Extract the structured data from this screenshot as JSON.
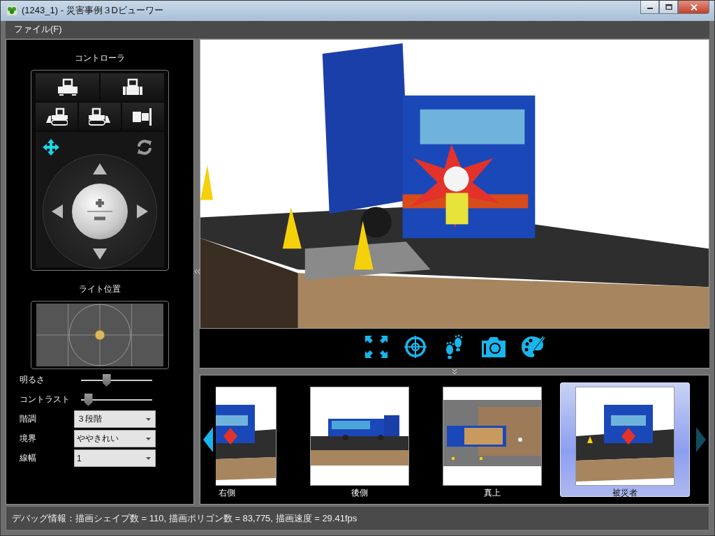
{
  "window": {
    "title": "(1243_1) - 災害事例３Dビューワー"
  },
  "menu": [
    {
      "label": "ファイル(F)"
    }
  ],
  "controller": {
    "title": "コントローラ",
    "view_buttons": [
      {
        "kind": "front"
      },
      {
        "kind": "back"
      },
      {
        "kind": "left"
      },
      {
        "kind": "right"
      },
      {
        "kind": "top"
      }
    ],
    "modes": [
      {
        "kind": "move",
        "selected": true
      },
      {
        "kind": "rotate",
        "selected": false
      }
    ]
  },
  "light": {
    "title": "ライト位置"
  },
  "sliders": [
    {
      "label": "明るさ",
      "level": 0.34
    },
    {
      "label": "コントラスト",
      "level": 0.05
    }
  ],
  "options": [
    {
      "label": "階調",
      "value": "３段階"
    },
    {
      "label": "境界",
      "value": "ややきれい"
    },
    {
      "label": "線幅",
      "value": "1"
    }
  ],
  "toolbar": [
    {
      "kind": "fullscreen"
    },
    {
      "kind": "target"
    },
    {
      "kind": "footprints"
    },
    {
      "kind": "camera"
    },
    {
      "kind": "palette"
    }
  ],
  "thumbnails": {
    "scroll_left": {
      "disabled": false
    },
    "scroll_right": {
      "disabled": true
    },
    "items": [
      {
        "label": "右側",
        "selected": false
      },
      {
        "label": "後側",
        "selected": false
      },
      {
        "label": "真上",
        "selected": false
      },
      {
        "label": "被災者",
        "selected": true
      }
    ]
  },
  "status_bar": {
    "text": "デバッグ情報：描画シェイプ数 = 110, 描画ポリゴン数 = 83,775, 描画速度 = 29.41fps"
  }
}
